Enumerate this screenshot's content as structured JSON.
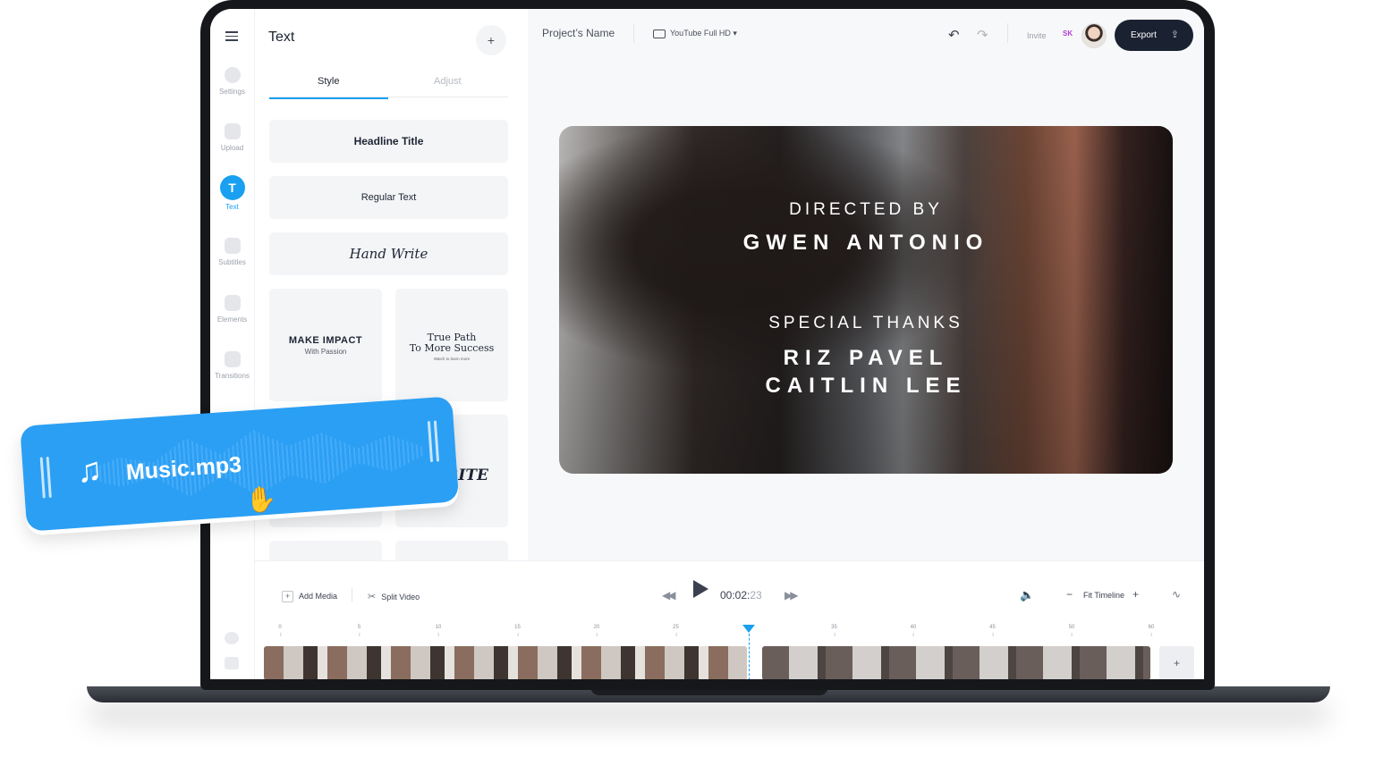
{
  "sidebar": {
    "items": [
      {
        "label": "Settings"
      },
      {
        "label": "Upload"
      },
      {
        "label": "Text",
        "icon_glyph": "T"
      },
      {
        "label": "Subtitles"
      },
      {
        "label": "Elements"
      },
      {
        "label": "Transitions"
      }
    ]
  },
  "panel": {
    "title": "Text",
    "add_glyph": "+",
    "tabs": [
      {
        "label": "Style"
      },
      {
        "label": "Adjust"
      }
    ],
    "styles": {
      "headline": "Headline Title",
      "regular": "Regular Text",
      "hand": "Hand Write",
      "impact_title": "MAKE IMPACT",
      "impact_sub": "With Passion",
      "path_title_1": "True Path",
      "path_title_2": "To More Success",
      "path_sub": "Watch to learn more",
      "write_partial": "RITE"
    }
  },
  "header": {
    "project_name": "Project’s Name",
    "preset": "YouTube Full HD",
    "preset_caret": "▾",
    "undo_glyph": "↶",
    "redo_glyph": "↷",
    "invite": "Invite",
    "user_initials": "SK",
    "export": "Export",
    "export_glyph": "⇪"
  },
  "preview": {
    "line1": "DIRECTED BY",
    "line2": "GWEN ANTONIO",
    "line3": "SPECIAL THANKS",
    "line4": "RIZ PAVEL",
    "line5": "CAITLIN LEE"
  },
  "timeline": {
    "add_media": "Add Media",
    "split_video": "Split Video",
    "rewind_glyph": "◀◀",
    "forward_glyph": "▶▶",
    "time_main": "00:02:",
    "time_frames": "23",
    "volume_glyph": "🔈",
    "zoom_out": "−",
    "fit": "Fit Timeline",
    "zoom_in": "+",
    "waveform_glyph": "∿",
    "add_clip_glyph": "+",
    "ruler": [
      "0",
      "5",
      "10",
      "15",
      "20",
      "25",
      "30",
      "35",
      "40",
      "45",
      "50",
      "55",
      "60"
    ]
  },
  "music": {
    "file_name": "Music.mp3",
    "note_glyph": "♫",
    "hand_glyph": "✋"
  },
  "colors": {
    "accent": "#1aa0f0",
    "export_bg": "#1a2130",
    "music_bg": "#2b9ff4",
    "initials": "#b13fd4"
  }
}
